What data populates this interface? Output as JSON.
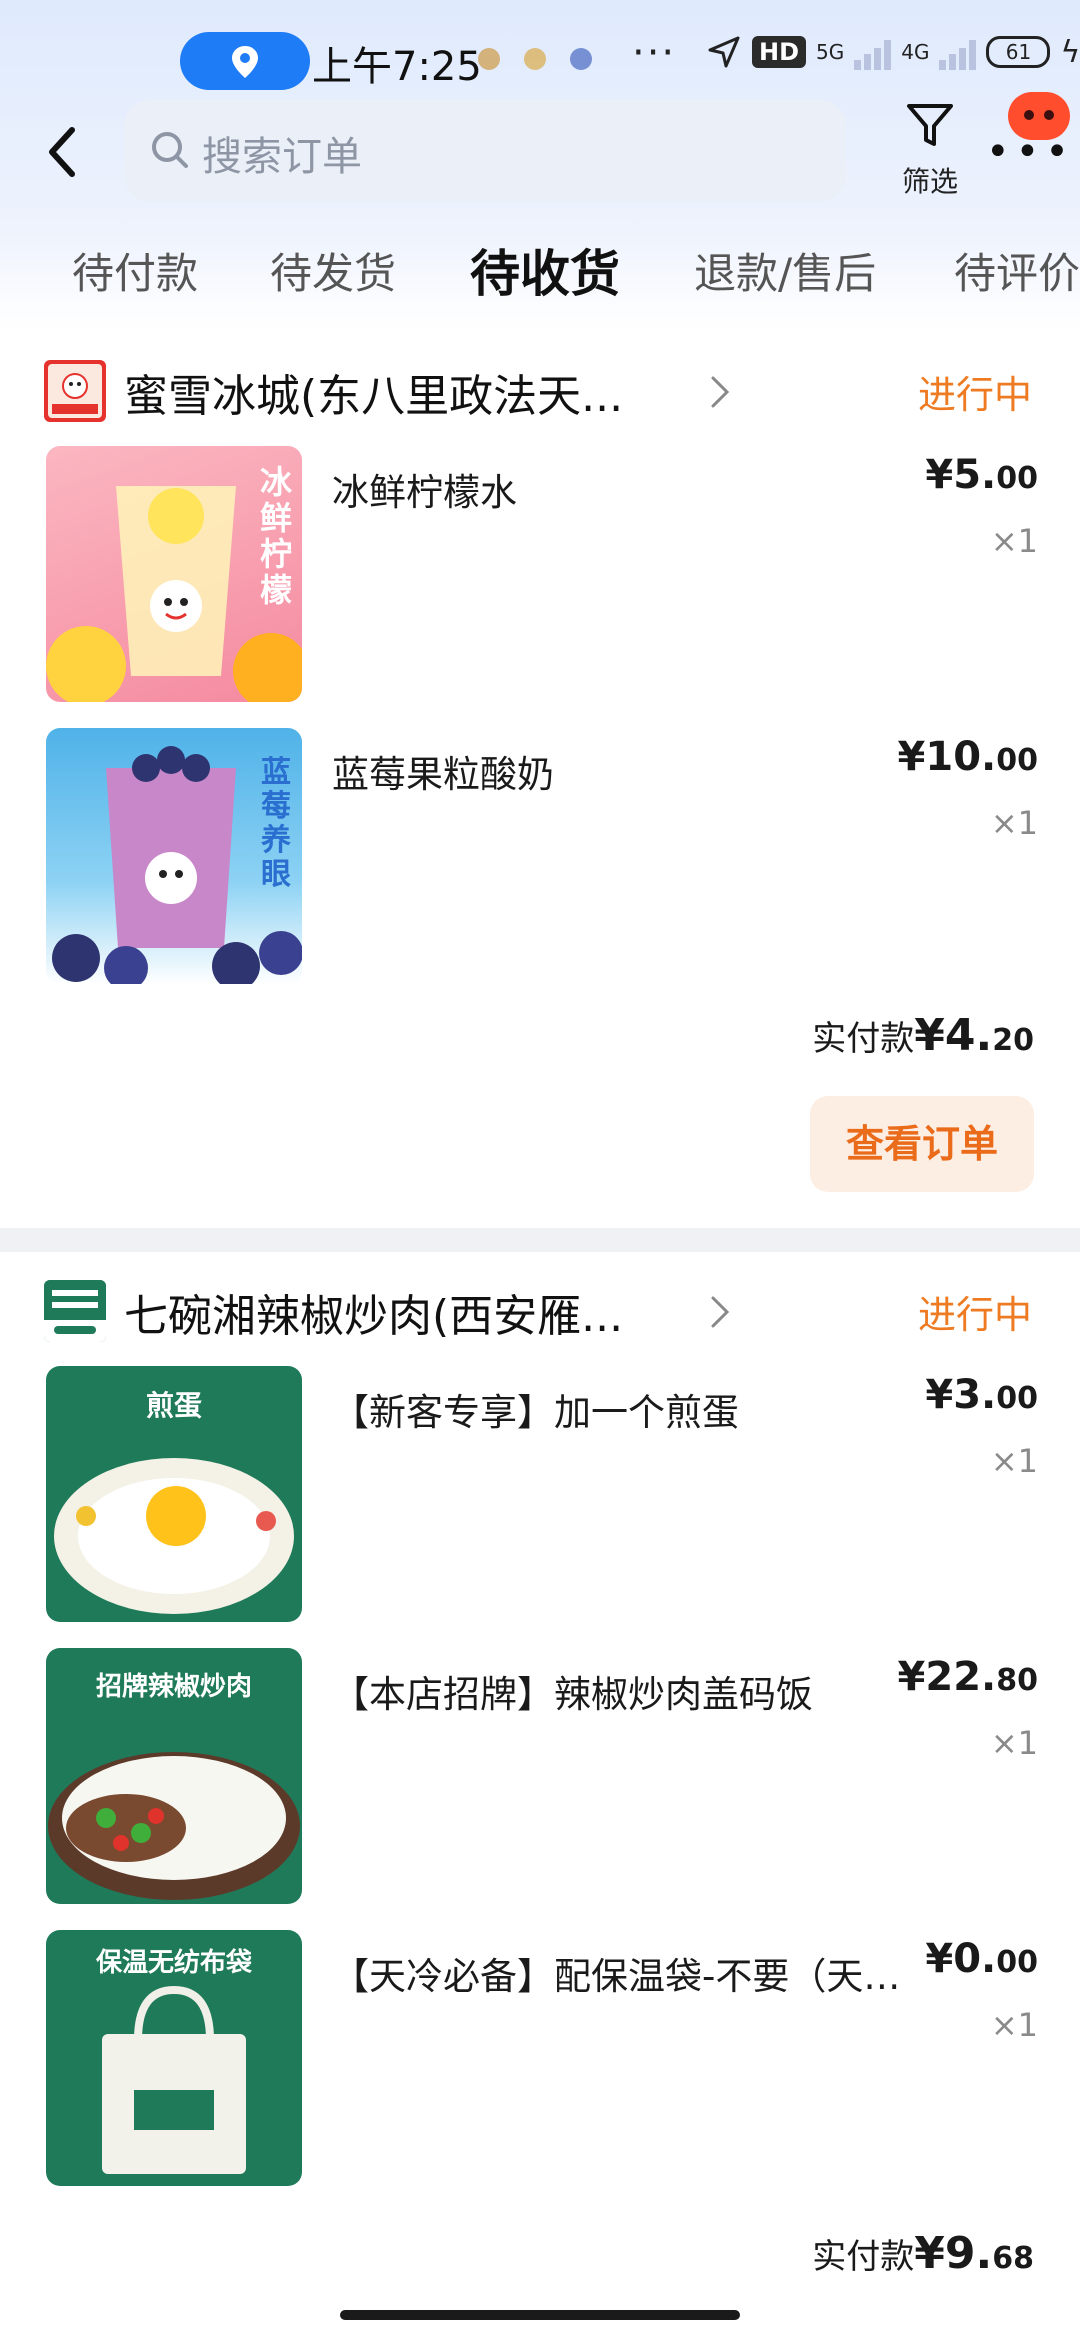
{
  "status_bar": {
    "time": "上午7:25",
    "hd": "HD",
    "net1": "5G",
    "net2": "4G",
    "battery": "61"
  },
  "nav": {
    "search_placeholder": "搜索订单",
    "filter_label": "筛选"
  },
  "tabs": [
    {
      "label": "待付款"
    },
    {
      "label": "待发货"
    },
    {
      "label": "待收货",
      "active": true
    },
    {
      "label": "退款/售后"
    },
    {
      "label": "待评价"
    }
  ],
  "orders": [
    {
      "store": "蜜雪冰城(东八里政法天...",
      "status": "进行中",
      "items": [
        {
          "name": "冰鲜柠檬水",
          "price_main": "¥5.",
          "price_dec": "00",
          "qty": "×1",
          "thumb_text": "冰鲜柠檬"
        },
        {
          "name": "蓝莓果粒酸奶",
          "price_main": "¥10.",
          "price_dec": "00",
          "qty": "×1",
          "thumb_text": "蓝莓养眼"
        }
      ],
      "paid_label": "实付款",
      "paid_main": "¥4.",
      "paid_dec": "20",
      "button": "查看订单"
    },
    {
      "store": "七碗湘辣椒炒肉(西安雁...",
      "status": "进行中",
      "items": [
        {
          "name": "【新客专享】加一个煎蛋",
          "price_main": "¥3.",
          "price_dec": "00",
          "qty": "×1",
          "thumb_text": "煎蛋"
        },
        {
          "name": "【本店招牌】辣椒炒肉盖码饭",
          "price_main": "¥22.",
          "price_dec": "80",
          "qty": "×1",
          "thumb_text": "招牌辣椒炒肉"
        },
        {
          "name": "【天冷必备】配保温袋-不要（天冷...",
          "price_main": "¥0.",
          "price_dec": "00",
          "qty": "×1",
          "thumb_text": "保温无纺布袋"
        }
      ],
      "paid_label": "实付款",
      "paid_main": "¥9.",
      "paid_dec": "68"
    }
  ],
  "colors": {
    "accent_orange": "#ee7b22",
    "button_bg": "#fdeee4",
    "store2_green": "#1f7a5a"
  }
}
